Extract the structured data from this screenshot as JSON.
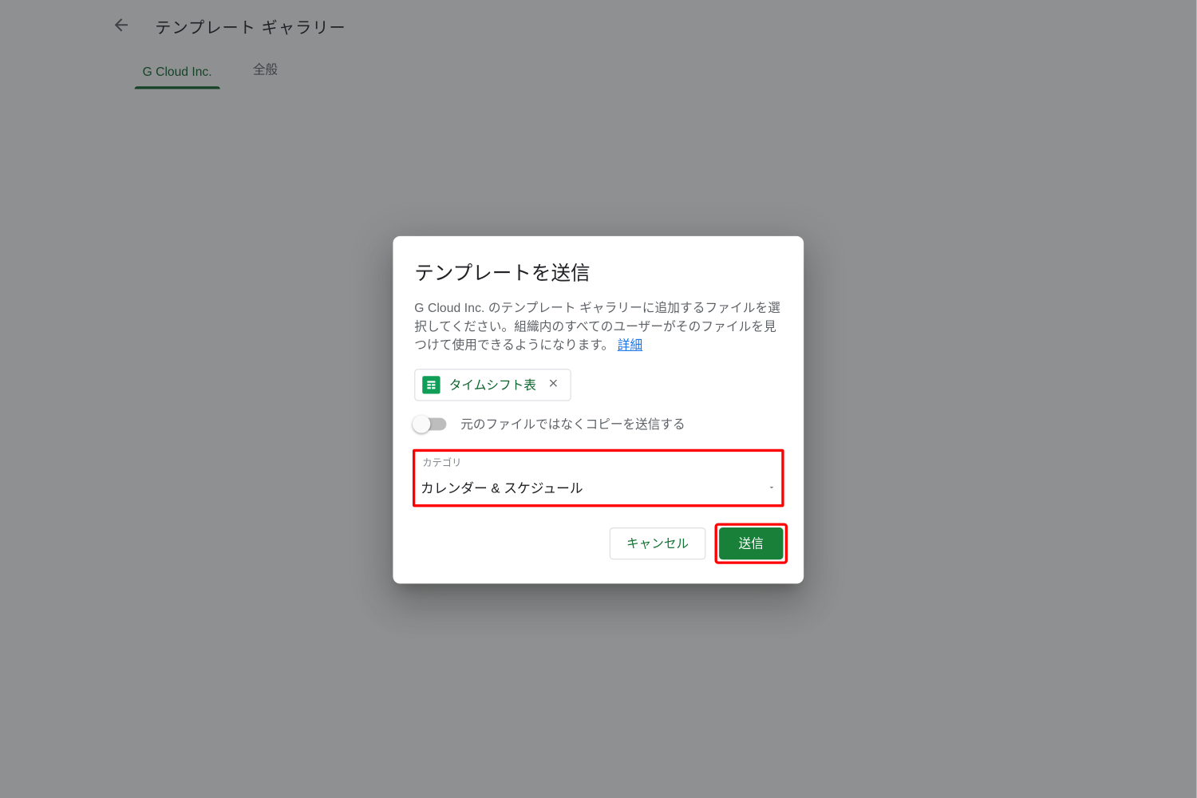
{
  "header": {
    "page_title": "テンプレート ギャラリー",
    "tabs": [
      {
        "label": "G Cloud Inc.",
        "active": true
      },
      {
        "label": "全般",
        "active": false
      }
    ]
  },
  "dialog": {
    "title": "テンプレートを送信",
    "description_pre": "G Cloud Inc. のテンプレート ギャラリーに追加するファイルを選択してください。組織内のすべてのユーザーがそのファイルを見つけて使用できるようになります。",
    "detail_link": "詳細",
    "file_chip": {
      "name": "タイムシフト表"
    },
    "copy_toggle": {
      "label": "元のファイルではなくコピーを送信する",
      "on": false
    },
    "category": {
      "legend": "カテゴリ",
      "value": "カレンダー & スケジュール"
    },
    "buttons": {
      "cancel": "キャンセル",
      "submit": "送信"
    }
  },
  "highlights": [
    "category-select",
    "submit-button"
  ]
}
